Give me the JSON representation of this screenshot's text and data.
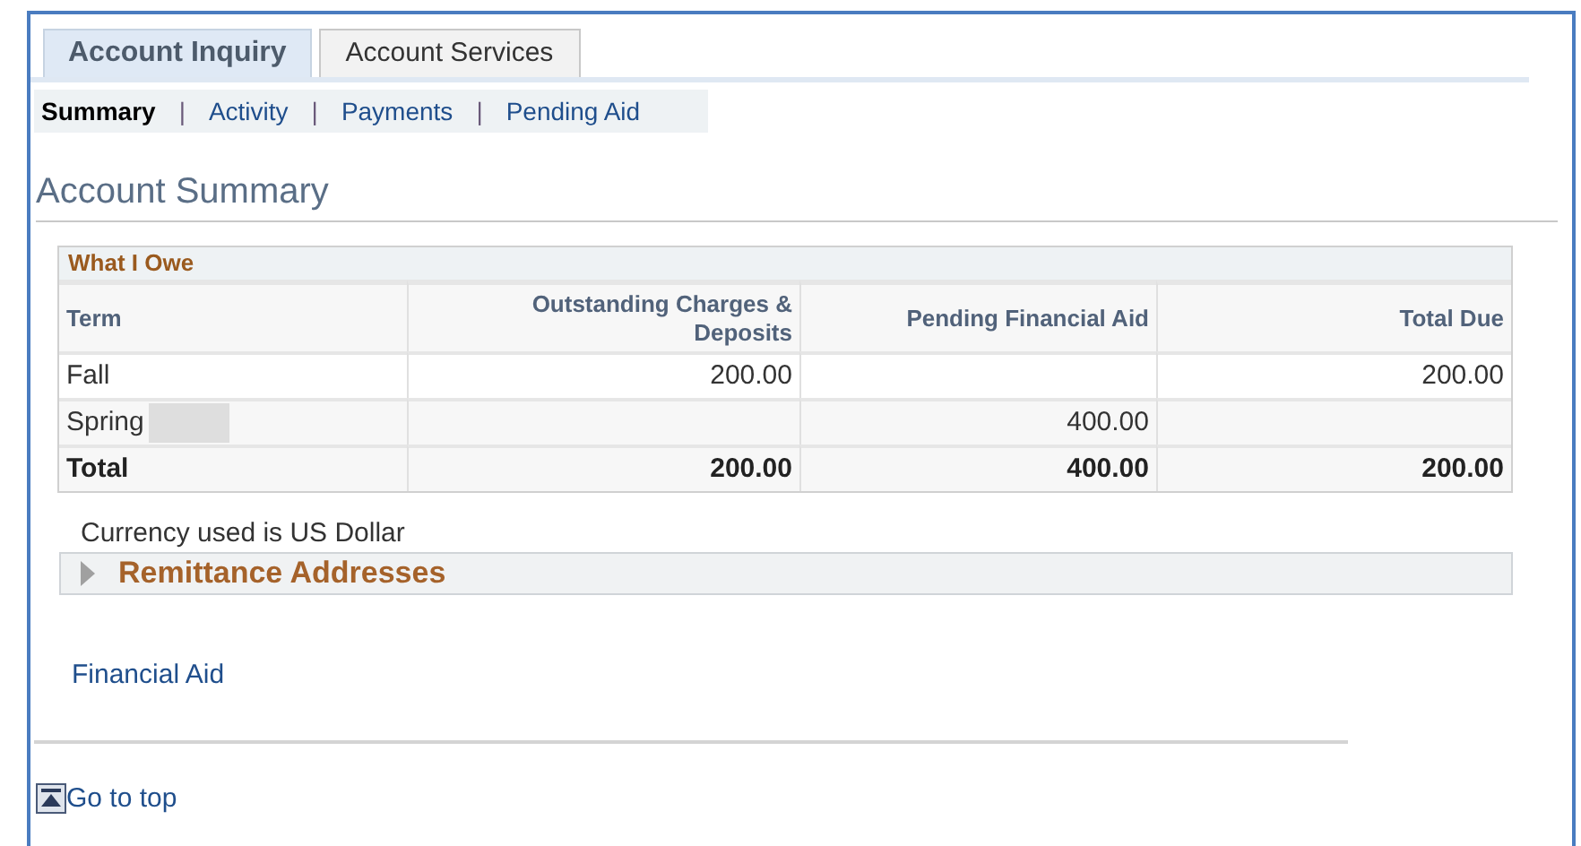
{
  "tabs": [
    {
      "label": "Account Inquiry",
      "selected": true
    },
    {
      "label": "Account Services",
      "selected": false
    }
  ],
  "subnav": [
    {
      "label": "Summary",
      "selected": true
    },
    {
      "label": "Activity",
      "selected": false
    },
    {
      "label": "Payments",
      "selected": false
    },
    {
      "label": "Pending Aid",
      "selected": false
    }
  ],
  "separator": "|",
  "heading": "Account Summary",
  "table": {
    "caption": "What I Owe",
    "columns": [
      "Term",
      "Outstanding Charges & Deposits",
      "Pending Financial Aid",
      "Total Due"
    ],
    "rows": [
      {
        "cells": [
          "Fall",
          "200.00",
          "",
          "200.00"
        ],
        "redacted": false,
        "total": false
      },
      {
        "cells": [
          "Spring",
          "",
          "400.00",
          ""
        ],
        "redacted": true,
        "total": false
      },
      {
        "cells": [
          "Total",
          "200.00",
          "400.00",
          "200.00"
        ],
        "redacted": false,
        "total": true
      }
    ]
  },
  "currency_note": "Currency used is US Dollar",
  "remittance": {
    "label": "Remittance Addresses",
    "expanded": false
  },
  "financial_aid_link": "Financial Aid",
  "go_to_top": "Go to top"
}
